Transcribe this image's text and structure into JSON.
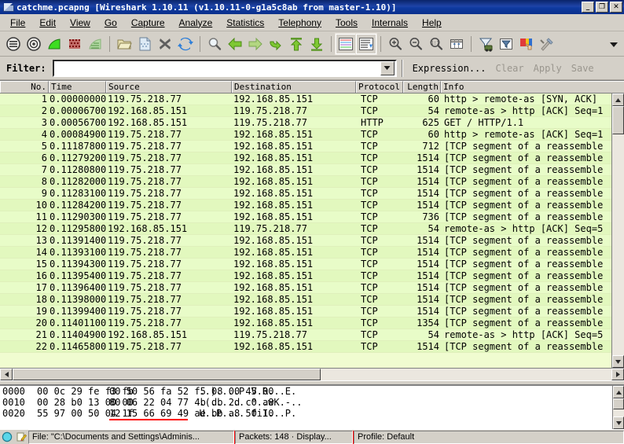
{
  "window": {
    "title": "catchme.pcapng   [Wireshark 1.10.11   (v1.10.11-0-g1a5c8ab from master-1.10)]",
    "icon": "wireshark-icon",
    "minimize_label": "_",
    "maximize_label": "❐",
    "close_label": "✕"
  },
  "menu": {
    "items": [
      {
        "label": "File",
        "accel": "F"
      },
      {
        "label": "Edit",
        "accel": "E"
      },
      {
        "label": "View",
        "accel": "V"
      },
      {
        "label": "Go",
        "accel": "G"
      },
      {
        "label": "Capture",
        "accel": "C"
      },
      {
        "label": "Analyze",
        "accel": "A"
      },
      {
        "label": "Statistics",
        "accel": "S"
      },
      {
        "label": "Telephony",
        "accel": "y"
      },
      {
        "label": "Tools",
        "accel": "T"
      },
      {
        "label": "Internals",
        "accel": "I"
      },
      {
        "label": "Help",
        "accel": "H"
      }
    ]
  },
  "toolbar": {
    "buttons": [
      {
        "name": "interfaces-icon",
        "title": "List the available capture interfaces"
      },
      {
        "name": "capture-options-icon",
        "title": "Show the capture options"
      },
      {
        "name": "start-capture-icon",
        "title": "Start a new live capture"
      },
      {
        "name": "stop-capture-icon",
        "title": "Stop the running live capture"
      },
      {
        "name": "restart-capture-icon",
        "title": "Restart the running live capture"
      },
      {
        "name": "open-file-icon",
        "title": "Open a capture file"
      },
      {
        "name": "save-file-icon",
        "title": "Save this capture file"
      },
      {
        "name": "close-file-icon",
        "title": "Close this capture file"
      },
      {
        "name": "reload-file-icon",
        "title": "Reload this capture file"
      },
      {
        "name": "find-packet-icon",
        "title": "Find a packet"
      },
      {
        "name": "go-back-icon",
        "title": "Go back in packet history"
      },
      {
        "name": "go-forward-icon",
        "title": "Go forward in packet history"
      },
      {
        "name": "go-to-packet-icon",
        "title": "Go to the packet with number"
      },
      {
        "name": "go-first-packet-icon",
        "title": "Go to the first packet"
      },
      {
        "name": "go-last-packet-icon",
        "title": "Go to the last packet"
      },
      {
        "name": "colorize-icon",
        "title": "Colorize packet list"
      },
      {
        "name": "auto-scroll-icon",
        "title": "Auto scroll in live capture"
      },
      {
        "name": "zoom-in-icon",
        "title": "Zoom in"
      },
      {
        "name": "zoom-out-icon",
        "title": "Zoom out"
      },
      {
        "name": "zoom-normal-icon",
        "title": "Zoom 1:1"
      },
      {
        "name": "resize-columns-icon",
        "title": "Resize columns"
      },
      {
        "name": "capture-filters-icon",
        "title": "Edit capture filters"
      },
      {
        "name": "display-filters-icon",
        "title": "Edit display filters"
      },
      {
        "name": "coloring-rules-icon",
        "title": "Edit coloring rules"
      },
      {
        "name": "preferences-icon",
        "title": "Edit preferences"
      },
      {
        "name": "toolbar-overflow-icon",
        "title": "More"
      }
    ]
  },
  "filter": {
    "label": "Filter:",
    "value": "",
    "placeholder": "",
    "dropdown_icon": "chevron-down-icon",
    "expression_label": "Expression...",
    "clear_label": "Clear",
    "apply_label": "Apply",
    "save_label": "Save"
  },
  "packet_list": {
    "columns": [
      {
        "key": "no",
        "label": "No."
      },
      {
        "key": "time",
        "label": "Time"
      },
      {
        "key": "src",
        "label": "Source"
      },
      {
        "key": "dst",
        "label": "Destination"
      },
      {
        "key": "proto",
        "label": "Protocol"
      },
      {
        "key": "len",
        "label": "Length"
      },
      {
        "key": "info",
        "label": "Info"
      }
    ],
    "rows": [
      {
        "no": "1",
        "time": "0.00000000",
        "src": "119.75.218.77",
        "dst": "192.168.85.151",
        "proto": "TCP",
        "len": "60",
        "info": "http > remote-as [SYN, ACK]"
      },
      {
        "no": "2",
        "time": "0.00006700",
        "src": "192.168.85.151",
        "dst": "119.75.218.77",
        "proto": "TCP",
        "len": "54",
        "info": "remote-as > http [ACK] Seq=1"
      },
      {
        "no": "3",
        "time": "0.00056700",
        "src": "192.168.85.151",
        "dst": "119.75.218.77",
        "proto": "HTTP",
        "len": "625",
        "info": "GET / HTTP/1.1"
      },
      {
        "no": "4",
        "time": "0.00084900",
        "src": "119.75.218.77",
        "dst": "192.168.85.151",
        "proto": "TCP",
        "len": "60",
        "info": "http > remote-as [ACK] Seq=1"
      },
      {
        "no": "5",
        "time": "0.11187800",
        "src": "119.75.218.77",
        "dst": "192.168.85.151",
        "proto": "TCP",
        "len": "712",
        "info": "[TCP segment of a reassemble"
      },
      {
        "no": "6",
        "time": "0.11279200",
        "src": "119.75.218.77",
        "dst": "192.168.85.151",
        "proto": "TCP",
        "len": "1514",
        "info": "[TCP segment of a reassemble"
      },
      {
        "no": "7",
        "time": "0.11280800",
        "src": "119.75.218.77",
        "dst": "192.168.85.151",
        "proto": "TCP",
        "len": "1514",
        "info": "[TCP segment of a reassemble"
      },
      {
        "no": "8",
        "time": "0.11282000",
        "src": "119.75.218.77",
        "dst": "192.168.85.151",
        "proto": "TCP",
        "len": "1514",
        "info": "[TCP segment of a reassemble"
      },
      {
        "no": "9",
        "time": "0.11283100",
        "src": "119.75.218.77",
        "dst": "192.168.85.151",
        "proto": "TCP",
        "len": "1514",
        "info": "[TCP segment of a reassemble"
      },
      {
        "no": "10",
        "time": "0.11284200",
        "src": "119.75.218.77",
        "dst": "192.168.85.151",
        "proto": "TCP",
        "len": "1514",
        "info": "[TCP segment of a reassemble"
      },
      {
        "no": "11",
        "time": "0.11290300",
        "src": "119.75.218.77",
        "dst": "192.168.85.151",
        "proto": "TCP",
        "len": "736",
        "info": "[TCP segment of a reassemble"
      },
      {
        "no": "12",
        "time": "0.11295800",
        "src": "192.168.85.151",
        "dst": "119.75.218.77",
        "proto": "TCP",
        "len": "54",
        "info": "remote-as > http [ACK] Seq=5"
      },
      {
        "no": "13",
        "time": "0.11391400",
        "src": "119.75.218.77",
        "dst": "192.168.85.151",
        "proto": "TCP",
        "len": "1514",
        "info": "[TCP segment of a reassemble"
      },
      {
        "no": "14",
        "time": "0.11393100",
        "src": "119.75.218.77",
        "dst": "192.168.85.151",
        "proto": "TCP",
        "len": "1514",
        "info": "[TCP segment of a reassemble"
      },
      {
        "no": "15",
        "time": "0.11394300",
        "src": "119.75.218.77",
        "dst": "192.168.85.151",
        "proto": "TCP",
        "len": "1514",
        "info": "[TCP segment of a reassemble"
      },
      {
        "no": "16",
        "time": "0.11395400",
        "src": "119.75.218.77",
        "dst": "192.168.85.151",
        "proto": "TCP",
        "len": "1514",
        "info": "[TCP segment of a reassemble"
      },
      {
        "no": "17",
        "time": "0.11396400",
        "src": "119.75.218.77",
        "dst": "192.168.85.151",
        "proto": "TCP",
        "len": "1514",
        "info": "[TCP segment of a reassemble"
      },
      {
        "no": "18",
        "time": "0.11398000",
        "src": "119.75.218.77",
        "dst": "192.168.85.151",
        "proto": "TCP",
        "len": "1514",
        "info": "[TCP segment of a reassemble"
      },
      {
        "no": "19",
        "time": "0.11399400",
        "src": "119.75.218.77",
        "dst": "192.168.85.151",
        "proto": "TCP",
        "len": "1514",
        "info": "[TCP segment of a reassemble"
      },
      {
        "no": "20",
        "time": "0.11401100",
        "src": "119.75.218.77",
        "dst": "192.168.85.151",
        "proto": "TCP",
        "len": "1354",
        "info": "[TCP segment of a reassemble"
      },
      {
        "no": "21",
        "time": "0.11404900",
        "src": "192.168.85.151",
        "dst": "119.75.218.77",
        "proto": "TCP",
        "len": "54",
        "info": "remote-as > http [ACK] Seq=5"
      },
      {
        "no": "22",
        "time": "0.11465800",
        "src": "119.75.218.77",
        "dst": "192.168.85.151",
        "proto": "TCP",
        "len": "1514",
        "info": "[TCP segment of a reassemble"
      }
    ]
  },
  "hex_pane": {
    "lines": [
      {
        "offset": "0000",
        "bytes1": "00 0c 29 fe f3 fb",
        "bytes2": "00 50 56 fa 52 f5 08 00 45 00",
        "ascii1": "..)....P",
        "ascii2": "V.R...E."
      },
      {
        "offset": "0010",
        "bytes1": "00 28 b0 13 00 00",
        "bytes2": "80 06 22 04 77 4b db 2d c0 a8",
        "ascii1": ".(......",
        "ascii2": "\"..wK.-.."
      },
      {
        "offset": "0020",
        "bytes1": "55 97 00 50 04 1f",
        "bytes2": "12 15 66 69 49 ae bb a8 50 10",
        "ascii1": "U..P....",
        "ascii2": "fiI...P."
      }
    ],
    "highlight_offset": "0020",
    "highlight_color": "#ff0000",
    "scroll_up_icon": "triangle-up-icon",
    "scroll_down_icon": "triangle-down-icon"
  },
  "statusbar": {
    "expert_icon": "expert-info-icon",
    "annotation_icon": "capture-comment-icon",
    "file_text": "File: \"C:\\Documents and Settings\\Adminis...",
    "packets_text": "Packets: 148 · Display...",
    "profile_text": "Profile: Default"
  },
  "colors": {
    "titlebar_start": "#0a246a",
    "titlebar_end": "#0a2f8c",
    "chrome": "#d4d0c8",
    "packet_row_a": "#e8fcc8",
    "packet_row_b": "#e2f8be",
    "hex_bg": "#ffffff",
    "highlight": "#ff0000"
  }
}
